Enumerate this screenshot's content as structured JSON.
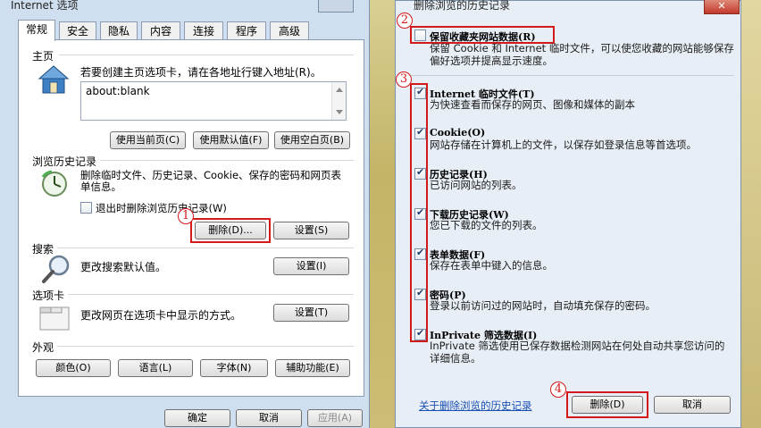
{
  "left_window": {
    "title": "Internet 选项",
    "tabs": [
      "常规",
      "安全",
      "隐私",
      "内容",
      "连接",
      "程序",
      "高级"
    ],
    "homepage": {
      "label": "主页",
      "description": "若要创建主页选项卡，请在各地址行键入地址(R)。",
      "address": "about:blank",
      "buttons": [
        "使用当前页(C)",
        "使用默认值(F)",
        "使用空白页(B)"
      ]
    },
    "history": {
      "label": "浏览历史记录",
      "description": "删除临时文件、历史记录、Cookie、保存的密码和网页表单信息。",
      "checkbox_label": "退出时删除浏览历史记录(W)",
      "delete_button": "删除(D)...",
      "settings_button": "设置(S)",
      "callout": "1"
    },
    "search": {
      "label": "搜索",
      "description": "更改搜索默认值。",
      "settings_button": "设置(I)"
    },
    "tabs_section": {
      "label": "选项卡",
      "description": "更改网页在选项卡中显示的方式。",
      "settings_button": "设置(T)"
    },
    "appearance": {
      "label": "外观",
      "buttons": [
        "颜色(O)",
        "语言(L)",
        "字体(N)",
        "辅助功能(E)"
      ]
    },
    "footer": {
      "ok": "确定",
      "cancel": "取消",
      "apply": "应用(A)"
    }
  },
  "right_window": {
    "title": "删除浏览的历史记录",
    "close_glyph": "✕",
    "preserve": {
      "title": "保留收藏夹网站数据(R)",
      "description": "保留 Cookie 和 Internet 临时文件，可以使您收藏的网站能够保存偏好选项并提高显示速度。",
      "checked": false,
      "callout": "2"
    },
    "items_callout": "3",
    "items": [
      {
        "title": "Internet 临时文件(T)",
        "description": "为快速查看而保存的网页、图像和媒体的副本",
        "checked": true
      },
      {
        "title": "Cookie(O)",
        "description": "网站存储在计算机上的文件，以保存如登录信息等首选项。",
        "checked": true
      },
      {
        "title": "历史记录(H)",
        "description": "已访问网站的列表。",
        "checked": true
      },
      {
        "title": "下载历史记录(W)",
        "description": "您已下载的文件的列表。",
        "checked": true
      },
      {
        "title": "表单数据(F)",
        "description": "保存在表单中键入的信息。",
        "checked": true
      },
      {
        "title": "密码(P)",
        "description": "登录以前访问过的网站时，自动填充保存的密码。",
        "checked": true
      },
      {
        "title": "InPrivate 筛选数据(I)",
        "description": "InPrivate 筛选使用已保存数据检测网站在何处自动共享您访问的详细信息。",
        "checked": true
      }
    ],
    "link": "关于删除浏览的历史记录",
    "delete_button": "删除(D)",
    "cancel_button": "取消",
    "delete_callout": "4"
  }
}
